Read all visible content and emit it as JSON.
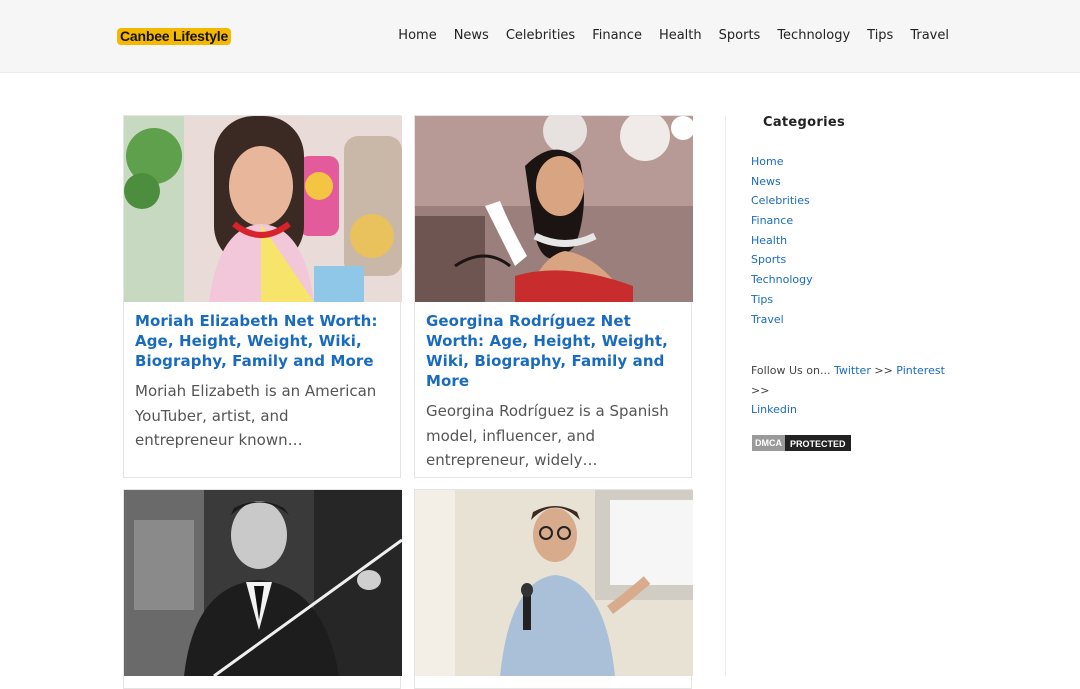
{
  "site": {
    "logo": "Canbee Lifestyle"
  },
  "nav": [
    "Home",
    "News",
    "Celebrities",
    "Finance",
    "Health",
    "Sports",
    "Technology",
    "Tips",
    "Travel"
  ],
  "posts": [
    {
      "title": "Moriah Elizabeth Net Worth: Age, Height, Weight, Wiki, Biography, Family and More",
      "excerpt": "Moriah Elizabeth is an American YouTuber, artist, and entrepreneur known…"
    },
    {
      "title": "Georgina Rodríguez Net Worth: Age, Height, Weight, Wiki, Biography, Family and More",
      "excerpt": "Georgina Rodríguez is a Spanish model, influencer, and entrepreneur, widely…"
    }
  ],
  "sidebar": {
    "title": "Categories",
    "items": [
      "Home",
      "News",
      "Celebrities",
      "Finance",
      "Health",
      "Sports",
      "Technology",
      "Tips",
      "Travel"
    ],
    "follow_prefix": "Follow Us on...",
    "follow_links": [
      "Twitter",
      "Pinterest",
      "Linkedin"
    ],
    "separator": ">>",
    "dmca_left": "DMCA",
    "dmca_right": "PROTECTED"
  }
}
